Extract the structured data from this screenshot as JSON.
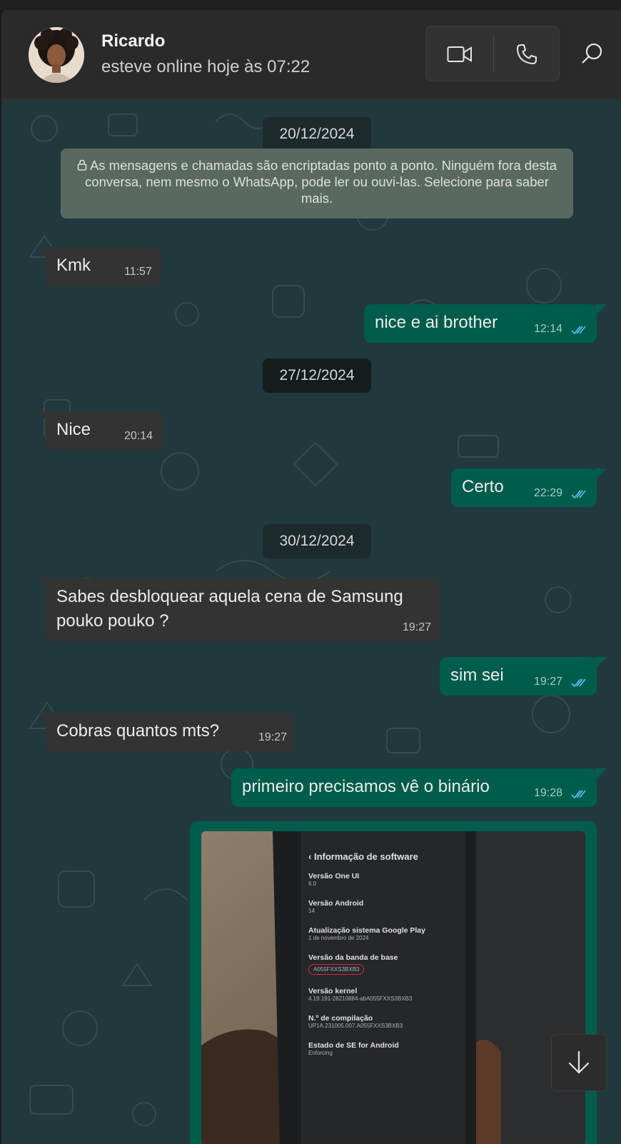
{
  "header": {
    "contact_name": "Ricardo",
    "status": "esteve online hoje às 07:22",
    "icons": [
      "video-call-icon",
      "voice-call-icon",
      "search-icon"
    ]
  },
  "chat": {
    "encryption_note": "As mensagens e chamadas são encriptadas ponto a ponto. Ninguém fora desta conversa, nem mesmo o WhatsApp, pode ler ou ouvi-las. Selecione para saber mais.",
    "dates": [
      "20/12/2024",
      "27/12/2024",
      "30/12/2024"
    ],
    "messages": [
      {
        "direction": "in",
        "text": "Kmk",
        "time": "11:57"
      },
      {
        "direction": "out",
        "text": "nice e ai brother",
        "time": "12:14",
        "status": "read"
      },
      {
        "direction": "in",
        "text": "Nice",
        "time": "20:14"
      },
      {
        "direction": "out",
        "text": "Certo",
        "time": "22:29",
        "status": "read"
      },
      {
        "direction": "in",
        "text": "Sabes desbloquear aquela cena de Samsung pouko pouko ?",
        "time": "19:27"
      },
      {
        "direction": "out",
        "text": "sim sei",
        "time": "19:27",
        "status": "read"
      },
      {
        "direction": "in",
        "text": "Cobras quantos mts?",
        "time": "19:27"
      },
      {
        "direction": "out",
        "text": "primeiro precisamos vê o binário",
        "time": "19:28",
        "status": "read"
      }
    ],
    "photo": {
      "title": "Informação de software",
      "rows": [
        {
          "label": "Versão One UI",
          "value": "6.0"
        },
        {
          "label": "Versão Android",
          "value": "14"
        },
        {
          "label": "Atualização sistema Google Play",
          "value": "1 de novembro de 2024"
        },
        {
          "label": "Versão da banda de base",
          "value": "A055FXXS3BXB3"
        },
        {
          "label": "Versão kernel",
          "value": "4.19.191-28210884-abA055FXXS3BXB3"
        },
        {
          "label": "N.º de compilação",
          "value": "UP1A.231005.007.A055FXXS3BXB3"
        },
        {
          "label": "Estado de SE for Android",
          "value": "Enforcing"
        }
      ]
    }
  },
  "colors": {
    "incoming_bubble": "#333333",
    "outgoing_bubble": "#005c4b",
    "read_ticks": "#53bdeb",
    "header_bg": "#2a2a2a"
  }
}
